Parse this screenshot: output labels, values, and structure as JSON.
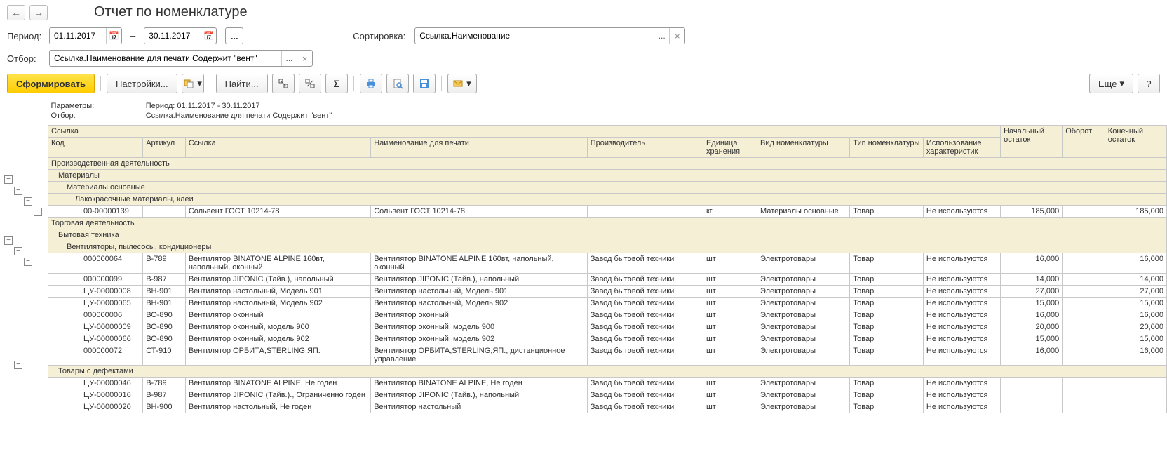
{
  "title": "Отчет по номенклатуре",
  "labels": {
    "period": "Период:",
    "filter": "Отбор:",
    "sort": "Сортировка:",
    "dash": "–",
    "more": "Еще",
    "help": "?"
  },
  "period": {
    "from": "01.11.2017",
    "to": "30.11.2017"
  },
  "filterValue": "Ссылка.Наименование для печати Содержит \"вент\"",
  "sortValue": "Ссылка.Наименование",
  "toolbar": {
    "generate": "Сформировать",
    "settings": "Настройки...",
    "find": "Найти..."
  },
  "params": {
    "label": "Параметры:",
    "text": "Период: 01.11.2017 - 30.11.2017",
    "filterLabel": "Отбор:",
    "filterText": "Ссылка.Наименование для печати Содержит \"вент\""
  },
  "headers": {
    "ssylka_top": "Ссылка",
    "code": "Код",
    "art": "Артикул",
    "ssylka": "Ссылка",
    "print": "Наименование для печати",
    "prod": "Производитель",
    "unit": "Единица хранения",
    "vid": "Вид номенклатуры",
    "tip": "Тип номенклатуры",
    "isp": "Использование характеристик",
    "nach": "Начальный остаток",
    "obor": "Оборот",
    "kon": "Конечный остаток"
  },
  "groups": {
    "g1": "Производственная деятельность",
    "g1_1": "Материалы",
    "g1_1_1": "Материалы основные",
    "g1_1_1_1": "Лакокрасочные материалы, клеи",
    "g2": "Торговая деятельность",
    "g2_1": "Бытовая техника",
    "g2_1_1": "Вентиляторы, пылесосы, кондиционеры",
    "g2_2": "Товары с дефектами"
  },
  "rows": [
    {
      "code": "00-00000139",
      "art": "",
      "ssylka": "Сольвент ГОСТ 10214-78",
      "print": "Сольвент ГОСТ 10214-78",
      "prod": "",
      "unit": "кг",
      "vid": "Материалы основные",
      "tip": "Товар",
      "isp": "Не используются",
      "nach": "185,000",
      "obor": "",
      "kon": "185,000"
    },
    {
      "code": "000000064",
      "art": "B-789",
      "ssylka": "Вентилятор BINATONE ALPINE 160вт, напольный, оконный",
      "print": "Вентилятор BINATONE ALPINE 160вт, напольный, оконный",
      "prod": "Завод бытовой техники",
      "unit": "шт",
      "vid": "Электротовары",
      "tip": "Товар",
      "isp": "Не используются",
      "nach": "16,000",
      "obor": "",
      "kon": "16,000"
    },
    {
      "code": "000000099",
      "art": "B-987",
      "ssylka": "Вентилятор JIPONIC (Тайв.), напольный",
      "print": "Вентилятор JIPONIC (Тайв.), напольный",
      "prod": "Завод бытовой техники",
      "unit": "шт",
      "vid": "Электротовары",
      "tip": "Товар",
      "isp": "Не используются",
      "nach": "14,000",
      "obor": "",
      "kon": "14,000"
    },
    {
      "code": "ЦУ-00000008",
      "art": "ВН-901",
      "ssylka": "Вентилятор настольный, Модель 901",
      "print": "Вентилятор настольный, Модель 901",
      "prod": "Завод бытовой техники",
      "unit": "шт",
      "vid": "Электротовары",
      "tip": "Товар",
      "isp": "Не используются",
      "nach": "27,000",
      "obor": "",
      "kon": "27,000"
    },
    {
      "code": "ЦУ-00000065",
      "art": "ВН-901",
      "ssylka": "Вентилятор настольный, Модель 902",
      "print": "Вентилятор настольный, Модель 902",
      "prod": "Завод бытовой техники",
      "unit": "шт",
      "vid": "Электротовары",
      "tip": "Товар",
      "isp": "Не используются",
      "nach": "15,000",
      "obor": "",
      "kon": "15,000"
    },
    {
      "code": "000000006",
      "art": "ВО-890",
      "ssylka": "Вентилятор оконный",
      "print": "Вентилятор оконный",
      "prod": "Завод бытовой техники",
      "unit": "шт",
      "vid": "Электротовары",
      "tip": "Товар",
      "isp": "Не используются",
      "nach": "16,000",
      "obor": "",
      "kon": "16,000"
    },
    {
      "code": "ЦУ-00000009",
      "art": "ВО-890",
      "ssylka": "Вентилятор оконный, модель 900",
      "print": "Вентилятор оконный, модель 900",
      "prod": "Завод бытовой техники",
      "unit": "шт",
      "vid": "Электротовары",
      "tip": "Товар",
      "isp": "Не используются",
      "nach": "20,000",
      "obor": "",
      "kon": "20,000"
    },
    {
      "code": "ЦУ-00000066",
      "art": "ВО-890",
      "ssylka": "Вентилятор оконный, модель 902",
      "print": "Вентилятор оконный, модель 902",
      "prod": "Завод бытовой техники",
      "unit": "шт",
      "vid": "Электротовары",
      "tip": "Товар",
      "isp": "Не используются",
      "nach": "15,000",
      "obor": "",
      "kon": "15,000"
    },
    {
      "code": "000000072",
      "art": "СТ-910",
      "ssylka": "Вентилятор ОРБИТА,STERLING,ЯП.",
      "print": "Вентилятор ОРБИТА,STERLING,ЯП., дистанционное управление",
      "prod": "Завод бытовой техники",
      "unit": "шт",
      "vid": "Электротовары",
      "tip": "Товар",
      "isp": "Не используются",
      "nach": "16,000",
      "obor": "",
      "kon": "16,000"
    },
    {
      "code": "ЦУ-00000046",
      "art": "B-789",
      "ssylka": "Вентилятор BINATONE ALPINE, Не годен",
      "print": "Вентилятор BINATONE ALPINE, Не годен",
      "prod": "Завод бытовой техники",
      "unit": "шт",
      "vid": "Электротовары",
      "tip": "Товар",
      "isp": "Не используются",
      "nach": "",
      "obor": "",
      "kon": ""
    },
    {
      "code": "ЦУ-00000016",
      "art": "B-987",
      "ssylka": "Вентилятор JIPONIC (Тайв.)., Ограниченно годен",
      "print": "Вентилятор JIPONIC (Тайв.), напольный",
      "prod": "Завод бытовой техники",
      "unit": "шт",
      "vid": "Электротовары",
      "tip": "Товар",
      "isp": "Не используются",
      "nach": "",
      "obor": "",
      "kon": ""
    },
    {
      "code": "ЦУ-00000020",
      "art": "ВН-900",
      "ssylka": "Вентилятор настольный, Не годен",
      "print": "Вентилятор настольный",
      "prod": "Завод бытовой техники",
      "unit": "шт",
      "vid": "Электротовары",
      "tip": "Товар",
      "isp": "Не используются",
      "nach": "",
      "obor": "",
      "kon": ""
    }
  ]
}
